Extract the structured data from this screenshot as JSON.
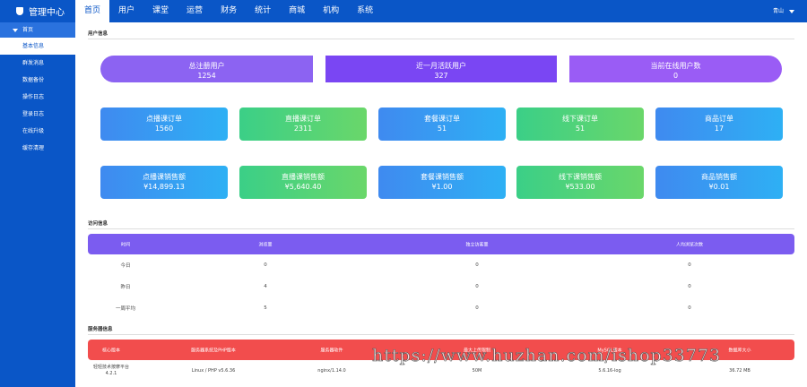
{
  "app": {
    "title": "管理中心",
    "user": "青山"
  },
  "nav": [
    "首页",
    "用户",
    "课堂",
    "运营",
    "财务",
    "统计",
    "商城",
    "机构",
    "系统"
  ],
  "sidebar": {
    "section": "首页",
    "items": [
      "基本信息",
      "群发消息",
      "数据备份",
      "操作日志",
      "登录日志",
      "在线升级",
      "缓存清理"
    ]
  },
  "user_info": {
    "title": "用户信息",
    "stats": [
      {
        "label": "总注册用户",
        "value": "1254"
      },
      {
        "label": "近一月活跃用户",
        "value": "327"
      },
      {
        "label": "当前在线用户数",
        "value": "0"
      }
    ]
  },
  "orders": [
    {
      "label": "点播课订单",
      "value": "1560"
    },
    {
      "label": "直播课订单",
      "value": "2311"
    },
    {
      "label": "套餐课订单",
      "value": "51"
    },
    {
      "label": "线下课订单",
      "value": "51"
    },
    {
      "label": "商品订单",
      "value": "17"
    }
  ],
  "sales": [
    {
      "label": "点播课销售额",
      "value": "¥14,899.13"
    },
    {
      "label": "直播课销售额",
      "value": "¥5,640.40"
    },
    {
      "label": "套餐课销售额",
      "value": "¥1.00"
    },
    {
      "label": "线下课销售额",
      "value": "¥533.00"
    },
    {
      "label": "商品销售额",
      "value": "¥0.01"
    }
  ],
  "visits": {
    "title": "访问信息",
    "headers": [
      "时间",
      "浏览量",
      "独立访客量",
      "人均浏览次数"
    ],
    "rows": [
      [
        "今日",
        "0",
        "0",
        "0"
      ],
      [
        "昨日",
        "4",
        "0",
        "0"
      ],
      [
        "一周平均",
        "5",
        "0",
        "0"
      ]
    ]
  },
  "server": {
    "title": "服务器信息",
    "headers": [
      "核心版本",
      "服务器系统及PHP版本",
      "服务器软件",
      "最大上传限制",
      "MySQL版本",
      "数据库大小"
    ],
    "row": [
      "轻轻技术按摩平台\n4.2.1",
      "Linux / PHP v5.6.36",
      "nginx/1.14.0",
      "50M",
      "5.6.16-log",
      "36.72 MB"
    ]
  },
  "watermark": "https://www.huzhan.com/ishop33773",
  "colors": {
    "primary": "#0a56c7",
    "purple": "#7b5cf0",
    "red": "#f24d4d",
    "blue": "#3f8af0",
    "green": "#3bcf87"
  }
}
